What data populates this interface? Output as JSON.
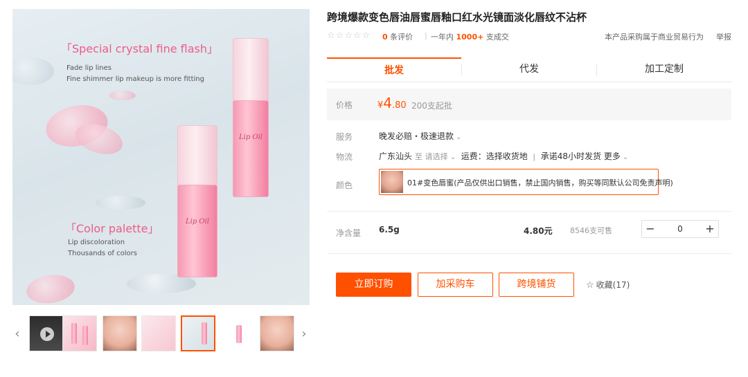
{
  "main_image": {
    "heading_1": "「Special crystal fine flash」",
    "sub_1_line1": "Fade lip lines",
    "sub_1_line2": "Fine shimmer lip makeup is more fitting",
    "heading_2": "「Color palette」",
    "sub_2_line1": "Lip discoloration",
    "sub_2_line2": "Thousands of colors",
    "bottle_label": "Lip Oil"
  },
  "thumbnails": {
    "prev_arrow": "‹",
    "next_arrow": "›"
  },
  "product": {
    "title": "跨境爆款变色唇油唇蜜唇釉口红水光镜面淡化唇纹不沾杯",
    "stars": "☆☆☆☆☆",
    "review_count": "0",
    "review_label": "条评价",
    "separator": "|",
    "year_label": "一年内",
    "deal_count": "1000+",
    "deal_label": "支成交",
    "trade_note": "本产品采购属于商业贸易行为",
    "report": "举报"
  },
  "tabs": [
    "批发",
    "代发",
    "加工定制"
  ],
  "price": {
    "label": "价格",
    "currency": "¥",
    "integer": "4",
    "decimal": ".80",
    "min_order": "200支起批"
  },
  "service": {
    "label": "服务",
    "value": "晚发必赔・极速退款"
  },
  "logistics": {
    "label": "物流",
    "origin": "广东汕头",
    "to": "至",
    "select": "请选择",
    "shipping": "运费：选择收货地",
    "separator": "|",
    "promise": "承诺48小时发货",
    "more": "更多"
  },
  "color": {
    "label": "颜色",
    "option": "01#变色唇蜜(产品仅供出口销售，禁止国内销售，购买等同默认公司免责声明)"
  },
  "sku": {
    "label": "净含量",
    "name": "6.5g",
    "price": "4.80元",
    "stock": "8546支可售",
    "minus": "−",
    "quantity": "0",
    "plus": "+"
  },
  "actions": {
    "buy_now": "立即订购",
    "add_cart": "加采购车",
    "cross_border": "跨境铺货",
    "favorite": "收藏(17)"
  },
  "colors": {
    "accent": "#ff5000",
    "heading_pink": "#ee5b86"
  }
}
